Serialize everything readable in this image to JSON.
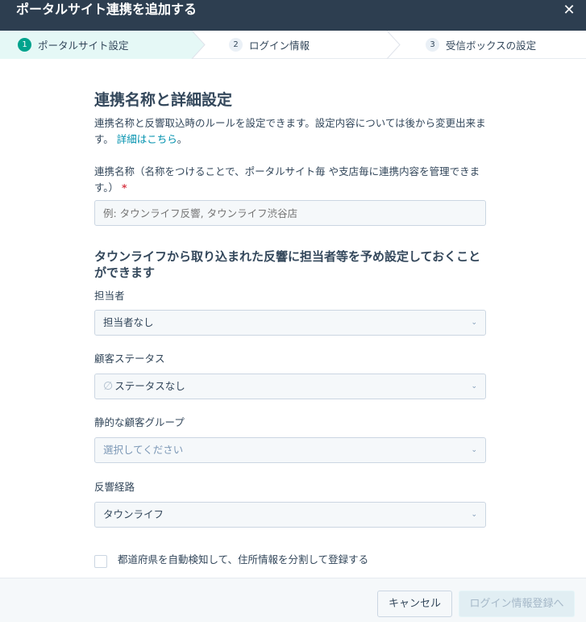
{
  "window": {
    "title": "ポータルサイト連携を追加する",
    "close_icon": "close-icon"
  },
  "steps": [
    {
      "num": "1",
      "label": "ポータルサイト設定",
      "active": true
    },
    {
      "num": "2",
      "label": "ログイン情報",
      "active": false
    },
    {
      "num": "3",
      "label": "受信ボックスの設定",
      "active": false
    }
  ],
  "colors": {
    "accent": "#00a38d",
    "header": "#2d3e50",
    "link": "#0091ae",
    "required": "#d93f4c"
  },
  "section1": {
    "title": "連携名称と詳細設定",
    "desc": "連携名称と反響取込時のルールを設定できます。設定内容については後から変更出来ます。",
    "link": "詳細はこちら",
    "link_suffix": "。"
  },
  "name_field": {
    "label": "連携名称（名称をつけることで、ポータルサイト毎 や支店毎に連携内容を管理できます。）",
    "required_mark": "*",
    "placeholder": "例: タウンライフ反響, タウンライフ渋谷店"
  },
  "section2": {
    "title": "タウンライフから取り込まれた反響に担当者等を予め設定しておくことができます"
  },
  "fields": {
    "owner": {
      "label": "担当者",
      "value": "担当者なし"
    },
    "status": {
      "label": "顧客ステータス",
      "value": "ステータスなし",
      "icon": "∅"
    },
    "group": {
      "label": "静的な顧客グループ",
      "value": "選択してください"
    },
    "route": {
      "label": "反響経路",
      "value": "タウンライフ"
    }
  },
  "caret": "⌄",
  "checkbox": {
    "label": "都道府県を自動検知して、住所情報を分割して登録する",
    "checked": false
  },
  "footer": {
    "cancel": "キャンセル",
    "next": "ログイン情報登録へ"
  }
}
